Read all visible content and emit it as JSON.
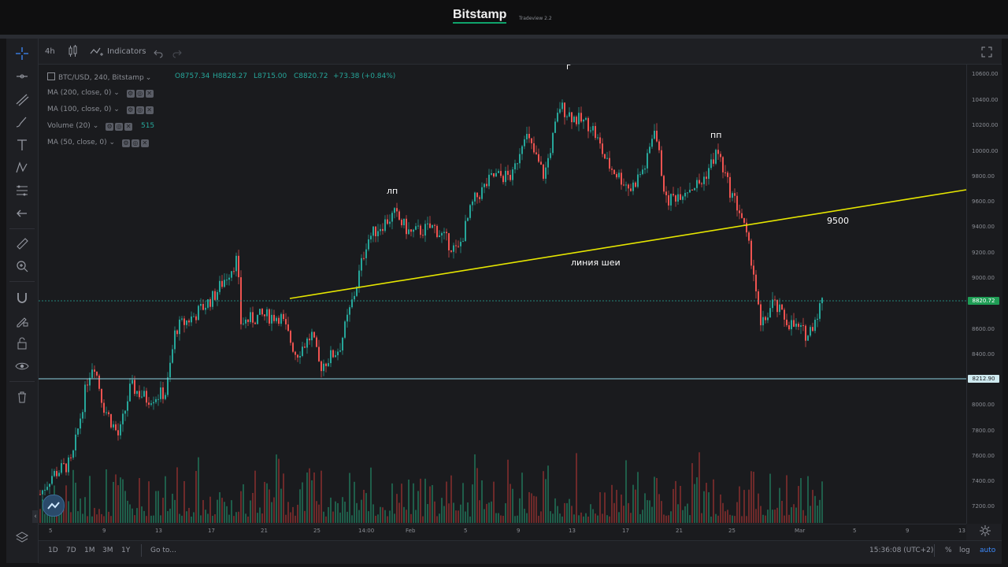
{
  "header": {
    "logo": "Bitstamp",
    "subtitle": "Tradeview 2.2"
  },
  "toolbar": {
    "interval": "4h",
    "indicators_label": "Indicators",
    "icons": [
      "candles-icon",
      "indicators-icon",
      "undo-icon",
      "redo-icon",
      "fullscreen-icon"
    ]
  },
  "left_toolbar": {
    "icons": [
      "crosshair-icon",
      "horizontal-line-icon",
      "trend-line-icon",
      "brush-icon",
      "text-icon",
      "pattern-icon",
      "fib-icon",
      "arrow-left-icon",
      "ruler-icon",
      "zoom-icon",
      "magnet-icon",
      "lock-drawing-icon",
      "unlock-icon",
      "eye-icon",
      "trash-icon",
      "layers-icon"
    ]
  },
  "legend": {
    "symbol": "BTC/USD, 240, Bitstamp",
    "open": "O8757.34",
    "high": "H8828.27",
    "low": "L8715.00",
    "close": "C8820.72",
    "change": "+73.38 (+0.84%)",
    "studies": [
      {
        "label": "MA (200, close, 0)"
      },
      {
        "label": "MA (100, close, 0)"
      },
      {
        "label": "Volume (20)",
        "value": "515"
      },
      {
        "label": "MA (50, close, 0)"
      }
    ]
  },
  "price_axis": {
    "ticks": [
      "10600.00",
      "10400.00",
      "10200.00",
      "10000.00",
      "9800.00",
      "9600.00",
      "9400.00",
      "9200.00",
      "9000.00",
      "8800.00",
      "8600.00",
      "8400.00",
      "8200.00",
      "8000.00",
      "7800.00",
      "7600.00",
      "7400.00",
      "7200.00"
    ],
    "current_price": "8820.72",
    "hline_price": "8212.90"
  },
  "time_axis": {
    "ticks": [
      "5",
      "9",
      "13",
      "17",
      "21",
      "25",
      "14:00",
      "Feb",
      "5",
      "9",
      "13",
      "17",
      "21",
      "25",
      "Mar",
      "5",
      "9",
      "13"
    ]
  },
  "annotations": {
    "left_shoulder": "лп",
    "head": "г",
    "right_shoulder": "пп",
    "neckline": "линия шеи",
    "target": "9500"
  },
  "bottom": {
    "ranges": [
      "1D",
      "7D",
      "1M",
      "3M",
      "1Y"
    ],
    "goto": "Go to...",
    "clock": "15:36:08 (UTC+2)",
    "percent": "%",
    "log": "log",
    "auto": "auto"
  },
  "colors": {
    "up": "#26a69a",
    "down": "#ef5350",
    "neckline": "#e6e600",
    "hline": "#8fd2e0",
    "current_price_bg": "#1f9d55"
  }
}
